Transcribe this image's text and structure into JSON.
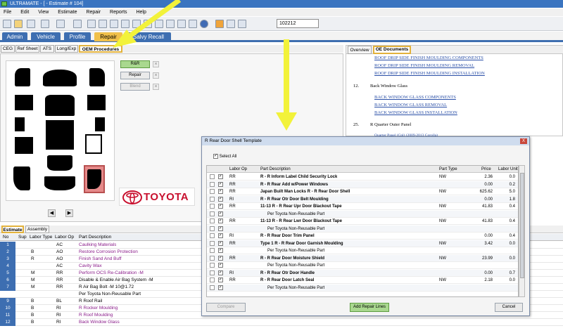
{
  "window": {
    "title": "ULTRAMATE - [ - Estimate # 104]"
  },
  "menu": [
    "File",
    "Edit",
    "View",
    "Estimate",
    "Repair",
    "Reports",
    "Help"
  ],
  "toolbar": {
    "estimate_number": "102212"
  },
  "main_tabs": [
    "Admin",
    "Vehicle",
    "Profile",
    "Repair",
    "Salvy Recall"
  ],
  "sub_tabs": [
    "CEG",
    "Ref Sheet",
    "ATS",
    "Long/Exp",
    "OEM Procedures"
  ],
  "actions": {
    "rr": "R&R",
    "repair": "Repair",
    "blend": "Blend"
  },
  "logo": {
    "text": "TOYOTA"
  },
  "right_tabs": [
    "Overview",
    "OE Documents"
  ],
  "oe_docs": {
    "links_top": [
      "ROOF DRIP SIDE FINISH MOULDING COMPONENTS",
      "ROOF DRIP SIDE FINISH MOULDING REMOVAL",
      "ROOF DRIP SIDE FINISH MOULDING INSTALLATION"
    ],
    "section12": {
      "num": "12.",
      "title": "Back Window Glass"
    },
    "links_12": [
      "BACK WINDOW GLASS COMPONENTS",
      "BACK WINDOW GLASS REMOVAL",
      "BACK WINDOW GLASS INSTALLATION"
    ],
    "section25": {
      "num": "25.",
      "title": "R Quarter Outer Panel"
    },
    "link_25": "Quarter Panel (Cpl) (2009-2013 Corolla)"
  },
  "dialog": {
    "title": "R Rear Door Shell Template",
    "close": "X",
    "select_all": "Select All",
    "columns": {
      "labor_op": "Labor Op",
      "part_description": "Part Description",
      "part_type": "Part Type",
      "price": "Price",
      "labor_unit": "Labor Unit"
    },
    "rows": [
      {
        "checked": true,
        "op": "RR",
        "desc": "R - R Inform Label Child Security Lock",
        "type": "NW",
        "price": "2.36",
        "unit": "0.0",
        "bold": true
      },
      {
        "checked": true,
        "op": "RR",
        "desc": "R - R Rear Add w/Power Windows",
        "type": "",
        "price": "0.00",
        "unit": "0.2",
        "bold": true
      },
      {
        "checked": true,
        "op": "RR",
        "desc": "Japan Built Man Locks R - R Rear Door Shell",
        "type": "NW",
        "price": "625.62",
        "unit": "5.0",
        "bold": true
      },
      {
        "checked": true,
        "op": "RI",
        "desc": "R - R Rear Otr Door Belt Moulding",
        "type": "",
        "price": "0.00",
        "unit": "1.8",
        "bold": true
      },
      {
        "checked": true,
        "op": "RR",
        "desc": "11-13 R - R Rear Upr Door Blackout Tape",
        "type": "NW",
        "price": "41.83",
        "unit": "0.4",
        "bold": true
      },
      {
        "checked": true,
        "op": "",
        "desc": "Per Toyota Non-Reusable Part",
        "type": "",
        "price": "",
        "unit": "",
        "bold": false
      },
      {
        "checked": true,
        "op": "RR",
        "desc": "11-13 R - R Rear Lwr Door Blackout Tape",
        "type": "NW",
        "price": "41.83",
        "unit": "0.4",
        "bold": true
      },
      {
        "checked": true,
        "op": "",
        "desc": "Per Toyota Non-Reusable Part",
        "type": "",
        "price": "",
        "unit": "",
        "bold": false
      },
      {
        "checked": true,
        "op": "RI",
        "desc": "R - R Rear Door Trim Panel",
        "type": "",
        "price": "0.00",
        "unit": "0.4",
        "bold": true
      },
      {
        "checked": true,
        "op": "RR",
        "desc": "Type 1 R - R Rear Door Garnish Moulding",
        "type": "NW",
        "price": "3.42",
        "unit": "0.0",
        "bold": true
      },
      {
        "checked": true,
        "op": "",
        "desc": "Per Toyota Non-Reusable Part",
        "type": "",
        "price": "",
        "unit": "",
        "bold": false
      },
      {
        "checked": true,
        "op": "RR",
        "desc": "R - R Rear Door Moisture Shield",
        "type": "NW",
        "price": "23.99",
        "unit": "0.0",
        "bold": true
      },
      {
        "checked": true,
        "op": "",
        "desc": "Per Toyota Non-Reusable Part",
        "type": "",
        "price": "",
        "unit": "",
        "bold": false
      },
      {
        "checked": true,
        "op": "RI",
        "desc": "R - R Rear Otr Door Handle",
        "type": "",
        "price": "0.00",
        "unit": "0.7",
        "bold": true
      },
      {
        "checked": true,
        "op": "RR",
        "desc": "R - R Rear Door Latch Seal",
        "type": "NW",
        "price": "2.18",
        "unit": "0.0",
        "bold": true
      },
      {
        "checked": true,
        "op": "",
        "desc": "Per Toyota Non-Reusable Part",
        "type": "",
        "price": "",
        "unit": "",
        "bold": false
      }
    ],
    "buttons": {
      "compare": "Compare",
      "add": "Add Repair Lines",
      "cancel": "Cancel"
    }
  },
  "estimate_tabs": [
    "Estimate",
    "Assembly"
  ],
  "estimate": {
    "columns": {
      "no": "No",
      "sup": "Sup",
      "labor_type": "Labor Type",
      "labor_op": "Labor Op",
      "part_description": "Part Description"
    },
    "rows": [
      {
        "no": "1",
        "sup": "",
        "type": "",
        "op": "AC",
        "desc": "Caulking Materials",
        "purple": true
      },
      {
        "no": "2",
        "sup": "",
        "type": "B",
        "op": "AO",
        "desc": "Restore Corrosion Protection",
        "purple": true
      },
      {
        "no": "3",
        "sup": "",
        "type": "R",
        "op": "AO",
        "desc": "Finish Sand And Buff",
        "purple": true
      },
      {
        "no": "4",
        "sup": "",
        "type": "",
        "op": "AC",
        "desc": "Cavity Wax",
        "purple": true
      },
      {
        "no": "5",
        "sup": "",
        "type": "M",
        "op": "RR",
        "desc": "Perform OCS Re-Calibration                 -M",
        "purple": true
      },
      {
        "no": "6",
        "sup": "",
        "type": "M",
        "op": "RR",
        "desc": "Disable & Enable Air Bag System          -M",
        "purple": false
      },
      {
        "no": "7",
        "sup": "",
        "type": "M",
        "op": "RR",
        "desc": "R Air Bag Bolt                                          -M 10@1.72",
        "purple": false
      },
      {
        "no": "",
        "sup": "",
        "type": "",
        "op": "",
        "desc": "Per Toyota Non-Reusable Part",
        "purple": false
      },
      {
        "no": "9",
        "sup": "",
        "type": "B",
        "op": "BL",
        "desc": "R Roof Rail",
        "purple": false
      },
      {
        "no": "10",
        "sup": "",
        "type": "B",
        "op": "RI",
        "desc": "R Rocker Moulding",
        "purple": true
      },
      {
        "no": "11",
        "sup": "",
        "type": "B",
        "op": "RI",
        "desc": "R Roof Moulding",
        "purple": true
      },
      {
        "no": "12",
        "sup": "",
        "type": "B",
        "op": "RI",
        "desc": "Back Window Glass",
        "purple": true
      }
    ]
  },
  "colors": {
    "tab_blue": "#3d6eb1",
    "active_tab": "#f0c04a",
    "arrow_yellow": "#f2f23a",
    "highlight_red": "#e58a8a"
  }
}
